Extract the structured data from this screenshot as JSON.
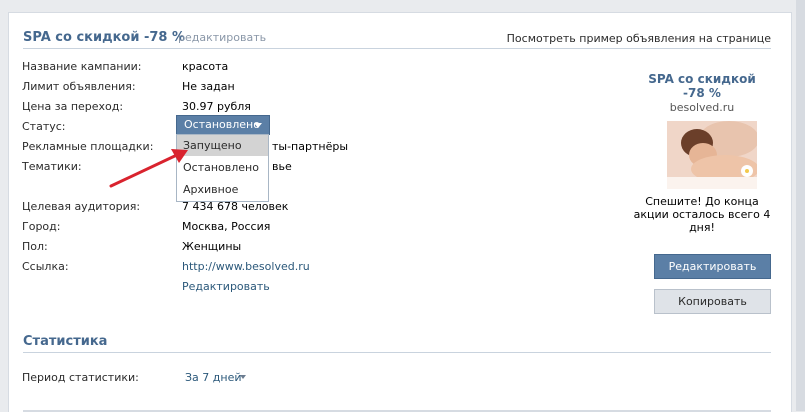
{
  "header": {
    "title": "SPA со скидкой -78 %",
    "edit_link": "редактировать",
    "preview_link": "Посмотреть пример объявления на странице"
  },
  "details": {
    "campaign_label": "Название кампании:",
    "campaign_value": "красота",
    "limit_label": "Лимит объявления:",
    "limit_value": "Не задан",
    "price_label": "Цена за переход:",
    "price_value": "30.97 рубля",
    "status_label": "Статус:",
    "platforms_label": "Рекламные площадки:",
    "platforms_value_partial": "ты-партнёры",
    "topics_label": "Тематики:",
    "topics_value_partial": "вье",
    "audience_label": "Целевая аудитория:",
    "audience_value": "7 434 678 человек",
    "city_label": "Город:",
    "city_value": "Москва, Россия",
    "gender_label": "Пол:",
    "gender_value": "Женщины",
    "link_label": "Ссылка:",
    "link_value": "http://www.besolved.ru",
    "edit_text": "Редактировать"
  },
  "status_dropdown": {
    "selected": "Остановлено",
    "options": [
      "Запущено",
      "Остановлено",
      "Архивное"
    ],
    "highlighted_index": 0
  },
  "ad_preview": {
    "title": "SPA со скидкой -78 %",
    "domain": "besolved.ru",
    "image_icon": "spa-woman-photo",
    "text": "Спешите! До конца акции осталось всего 4 дня!"
  },
  "buttons": {
    "edit": "Редактировать",
    "copy": "Копировать"
  },
  "statistics": {
    "title": "Статистика",
    "period_label": "Период статистики:",
    "period_value": "За 7 дней"
  },
  "colors": {
    "accent": "#45688e",
    "button_blue": "#5b7fa6",
    "annotation_arrow": "#d9232e"
  }
}
